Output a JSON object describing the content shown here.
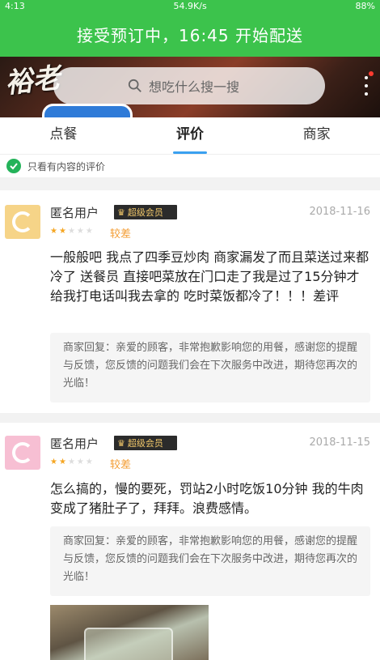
{
  "status": {
    "time": "4:13",
    "speed": "54.9K/s",
    "battery": "88%"
  },
  "banner": {
    "text": "接受预订中，16:45 开始配送"
  },
  "hero": {
    "search_placeholder": "想吃什么搜一搜"
  },
  "tabs": [
    {
      "label": "点餐"
    },
    {
      "label": "评价"
    },
    {
      "label": "商家"
    }
  ],
  "filter": {
    "label": "只看有内容的评价",
    "checked": true
  },
  "reviews": [
    {
      "user": "匿名用户",
      "badge": "超级会员",
      "date": "2018-11-16",
      "stars": 2,
      "rating_text": "较差",
      "avatar_color": "#f6d488",
      "content": "一般般吧 我点了四季豆炒肉 商家漏发了而且菜送过来都冷了 送餐员 直接吧菜放在门口走了我是过了15分钟才给我打电话叫我去拿的 吃时菜饭都冷了！！！差评",
      "reply": "商家回复：亲爱的顾客，非常抱歉影响您的用餐，感谢您的提醒与反馈，您反馈的问题我们会在下次服务中改进，期待您再次的光临！"
    },
    {
      "user": "匿名用户",
      "badge": "超级会员",
      "date": "2018-11-15",
      "stars": 2,
      "rating_text": "较差",
      "avatar_color": "#f7bfd3",
      "content": "怎么搞的，慢的要死，罚站2小时吃饭10分钟 我的牛肉变成了猪肚子了，拜拜。浪费感情。",
      "reply": "商家回复：亲爱的顾客，非常抱歉影响您的用餐，感谢您的提醒与反馈，您反馈的问题我们会在下次服务中改进，期待您再次的光临！"
    }
  ]
}
